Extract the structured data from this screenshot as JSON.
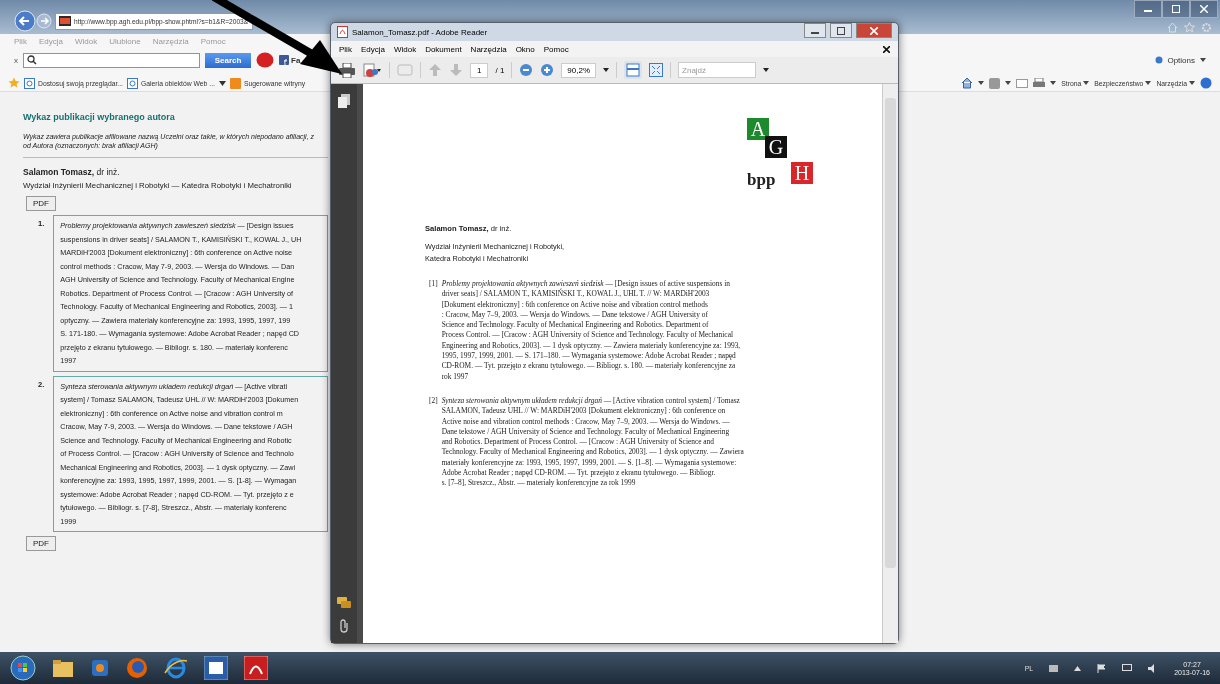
{
  "browser": {
    "address": "http://www.bpp.agh.edu.pl/bpp-show.phtml?s=b1&R=2003&",
    "menu": [
      "Plik",
      "Edycja",
      "Widok",
      "Ulubione",
      "Narzędzia",
      "Pomoc"
    ],
    "close_label": "x",
    "search_button": "Search",
    "facebook_label": "Fa",
    "favorites": [
      "Dostosuj swoją przeglądar...",
      "Galeria obiektów Web ...",
      "Sugerowane witryny"
    ],
    "options": "Options",
    "commands": [
      "Strona",
      "Bezpieczeństwo",
      "Narzędzia"
    ]
  },
  "page": {
    "heading": "Wykaz publikacji wybranego autora",
    "note_lines": [
      "Wykaz zawiera publikacje afiliowane nazwą Uczelni oraz takie, w których niepodano afiliacji, z",
      "od Autora (oznaczonych: brak afiliacji AGH)"
    ],
    "author_name": "Salamon Tomasz,",
    "author_title": "dr inż.",
    "department": "Wydział Inżynierii Mechanicznej i Robotyki — Katedra Robotyki i Mechatroniki",
    "pdf_buttons": [
      "PDF",
      "PDF"
    ],
    "publications": [
      {
        "number": "1.",
        "lines": [
          "*Problemy projektowania aktywnych zawieszeń siedzisk* — [Design issues",
          "suspensions in driver seats] / SALAMON T., KAMISIŃSKI T., KOWAL J., UH",
          "MARDiH'2003 [Dokument elektroniczny] : 6th conference on Active noise",
          "control methods : Cracow, May 7-9, 2003. — Wersja do Windows. — Dan",
          "AGH University of Science and Technology. Faculty of Mechanical Engine",
          "Robotics. Department of Process Control. — [Cracow : AGH University of",
          "Technology. Faculty of Mechanical Engineering and Robotics, 2003]. — 1",
          "optyczny. — Zawiera materiały konferencyjne za: 1993, 1995, 1997, 199",
          "S. 171-180. — Wymagania systemowe: Adobe Acrobat Reader ; napęd CD",
          "przejęto z ekranu tytułowego. — Bibliogr. s. 180. — materiały konferenc",
          "1997"
        ]
      },
      {
        "number": "2.",
        "lines": [
          "*Synteza sterowania aktywnym układem redukcji drgań* — [Active vibrati",
          "system] / Tomasz SALAMON, Tadeusz UHL // W: MARDiH'2003 [Dokumen",
          "elektroniczny] : 6th conference on Active noise and vibration control m",
          "Cracow, May 7-9, 2003. — Wersja do Windows. — Dane tekstowe / AGH",
          "Science and Technology. Faculty of Mechanical Engineering and Robotic",
          "of Process Control. — [Cracow : AGH University of Science and Technolo",
          "Mechanical Engineering and Robotics, 2003]. — 1 dysk optyczny. — Zawi",
          "konferencyjne za: 1993, 1995, 1997, 1999, 2001. — S. [1-8]. — Wymagan",
          "systemowe: Adobe Acrobat Reader ; napęd CD-ROM. — Tyt. przejęto z e",
          "tytułowego. — Bibliogr. s. [7-8], Streszcz., Abstr. — materiały konferenc",
          "1999"
        ]
      }
    ]
  },
  "reader": {
    "title": "Salamon_Tomasz.pdf - Adobe Reader",
    "menu": [
      "Plik",
      "Edycja",
      "Widok",
      "Dokument",
      "Narzędzia",
      "Okno",
      "Pomoc"
    ],
    "page_number": "1",
    "page_total": "/ 1",
    "zoom": "90,2%",
    "find_placeholder": "Znajdź",
    "document": {
      "logo_letters": [
        "A",
        "G",
        "H"
      ],
      "logo_text": "bpp",
      "author_name": "Salamon Tomasz,",
      "author_title": "dr inż.",
      "affiliation_lines": [
        "Wydział Inżynierii Mechanicznej i Robotyki,",
        "Katedra Robotyki i Mechatroniki"
      ],
      "entries": [
        {
          "number": "[1]",
          "lines": [
            "*Problemy projektowania aktywnych zawieszeń siedzisk* — [Design issues of active suspensions in",
            "driver seats] / SALAMON T., KAMISIŃSKI T., KOWAL J., UHL T. // W: MARDiH'2003",
            "[Dokument elektroniczny] : 6th conference on Active noise and vibration control methods",
            ": Cracow, May 7–9, 2003. — Wersja do Windows. — Dane tekstowe / AGH University of",
            "Science and Technology. Faculty of Mechanical Engineering and Robotics. Department of",
            "Process Control. — [Cracow : AGH University of Science and Technology. Faculty of Mechanical",
            "Engineering and Robotics, 2003]. — 1 dysk optyczny. — Zawiera materiały konferencyjne za: 1993,",
            "1995, 1997, 1999, 2001. — S. 171–180. — Wymagania systemowe: Adobe Acrobat Reader ; napęd",
            "CD-ROM. — Tyt. przejęto z ekranu tytułowego. — Bibliogr. s. 180. — materiały konferencyjne za",
            "rok 1997"
          ]
        },
        {
          "number": "[2]",
          "lines": [
            "*Synteza sterowania aktywnym układem redukcji drgań* — [Active vibration control system] / Tomasz",
            "SALAMON, Tadeusz UHL // W: MARDiH'2003 [Dokument elektroniczny] : 6th conference on",
            "Active noise and vibration control methods : Cracow, May 7–9, 2003. — Wersja do Windows. —",
            "Dane tekstowe / AGH University of Science and Technology. Faculty of Mechanical Engineering",
            "and Robotics. Department of Process Control. — [Cracow : AGH University of Science and",
            "Technology. Faculty of Mechanical Engineering and Robotics, 2003]. — 1 dysk optyczny. — Zawiera",
            "materiały konferencyjne za: 1993, 1995, 1997, 1999, 2001. — S. [1–8]. — Wymagania systemowe:",
            "Adobe Acrobat Reader ; napęd CD-ROM. — Tyt. przejęto z ekranu tytułowego. — Bibliogr.",
            "s. [7–8], Streszcz., Abstr. — materiały konferencyjne za rok 1999"
          ]
        }
      ]
    }
  },
  "taskbar": {
    "language": "PL",
    "time": "07:27",
    "date": "2013-07-16"
  }
}
